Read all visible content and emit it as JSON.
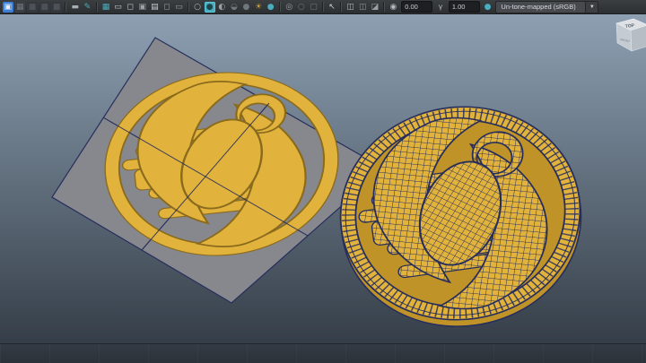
{
  "colors": {
    "grad_top": "#8da0b2",
    "grad_bottom": "#353e48",
    "plane": "#86888d",
    "wire": "#272e5c",
    "yellow": "#e2b33c",
    "yellow_dark": "#bf9327",
    "yellow_deep": "#8a6a1c",
    "accent": "#49aebf",
    "toolbar_bg": "#323538"
  },
  "toolbar": {
    "icons": [
      {
        "name": "select-camera-icon",
        "glyph": "▣",
        "fg": "#e8eef6",
        "bg": "#3d7fd8"
      },
      {
        "name": "lock-camera-icon",
        "glyph": "▦",
        "fg": "#70767d",
        "bg": "#3a3f45"
      },
      {
        "name": "camera-attributes-icon",
        "glyph": "■",
        "fg": "#4d5258",
        "bg": "#35393e"
      },
      {
        "name": "bookmarks-icon",
        "glyph": "■",
        "fg": "#4d5258",
        "bg": "#35393e"
      },
      {
        "name": "image-plane-icon",
        "glyph": "■",
        "fg": "#4d5258",
        "bg": "#35393e"
      },
      {
        "sep": true
      },
      {
        "name": "two-d-pan-zoom-icon",
        "glyph": "▬",
        "fg": "#a9afb5",
        "bg": "transparent"
      },
      {
        "name": "grease-pencil-icon",
        "glyph": "✎",
        "fg": "#49aebf",
        "bg": "transparent"
      },
      {
        "sep": true
      },
      {
        "name": "grid-icon",
        "glyph": "▦",
        "fg": "#49aebf",
        "bg": "transparent"
      },
      {
        "name": "film-gate-icon",
        "glyph": "▭",
        "fg": "#c8ced4",
        "bg": "transparent"
      },
      {
        "name": "resolution-gate-icon",
        "glyph": "◻",
        "fg": "#c8ced4",
        "bg": "transparent"
      },
      {
        "name": "gate-mask-icon",
        "glyph": "▣",
        "fg": "#9aa0a6",
        "bg": "transparent"
      },
      {
        "name": "field-chart-icon",
        "glyph": "▤",
        "fg": "#c8ced4",
        "bg": "transparent"
      },
      {
        "name": "safe-action-icon",
        "glyph": "◻",
        "fg": "#9aa0a6",
        "bg": "transparent"
      },
      {
        "name": "safe-title-icon",
        "glyph": "▭",
        "fg": "#9aa0a6",
        "bg": "transparent"
      },
      {
        "sep": true
      },
      {
        "name": "wireframe-icon",
        "glyph": "○",
        "fg": "#b4bac0",
        "bg": "transparent"
      },
      {
        "name": "smooth-shade-all-icon",
        "glyph": "●",
        "fg": "#1d454e",
        "bg": "#49aebf",
        "active": true
      },
      {
        "name": "wireframe-on-shaded-icon",
        "glyph": "◐",
        "fg": "#9aa0a6",
        "bg": "transparent"
      },
      {
        "name": "textured-icon",
        "glyph": "◒",
        "fg": "#70767d",
        "bg": "transparent"
      },
      {
        "name": "use-default-material-icon",
        "glyph": "●",
        "fg": "#70767d",
        "bg": "transparent"
      },
      {
        "name": "lights-icon",
        "glyph": "☀",
        "fg": "#c8a23f",
        "bg": "transparent"
      },
      {
        "name": "shadows-icon",
        "glyph": "●",
        "fg": "#49aebf",
        "bg": "transparent"
      },
      {
        "sep": true
      },
      {
        "name": "ssao-icon",
        "glyph": "◎",
        "fg": "#9aa0a6",
        "bg": "transparent"
      },
      {
        "name": "motion-blur-icon",
        "glyph": "○",
        "fg": "#70767d",
        "bg": "transparent"
      },
      {
        "name": "anti-aliasing-icon",
        "glyph": "▢",
        "fg": "#70767d",
        "bg": "transparent"
      },
      {
        "sep": true
      },
      {
        "name": "isolate-select-icon",
        "glyph": "↖",
        "fg": "#c8ced4",
        "bg": "transparent"
      },
      {
        "sep": true
      },
      {
        "name": "xray-icon",
        "glyph": "◫",
        "fg": "#b4bac0",
        "bg": "transparent"
      },
      {
        "name": "xray-joints-icon",
        "glyph": "◫",
        "fg": "#8d9399",
        "bg": "transparent"
      },
      {
        "name": "backface-culling-icon",
        "glyph": "◪",
        "fg": "#9aa0a6",
        "bg": "transparent"
      },
      {
        "sep": true
      },
      {
        "name": "exposure-icon",
        "glyph": "◉",
        "fg": "#b4bac0",
        "bg": "transparent"
      }
    ],
    "exposure_value": "0.00",
    "gamma_glyph": "γ",
    "gamma_value": "1.00",
    "tonemap_glyph": "●",
    "view_transform_value": "Un-tone-mapped (sRGB)",
    "dropdown_arrow": "▼"
  },
  "viewcube": {
    "top_label": "TOP",
    "front_label": "FRONT"
  }
}
